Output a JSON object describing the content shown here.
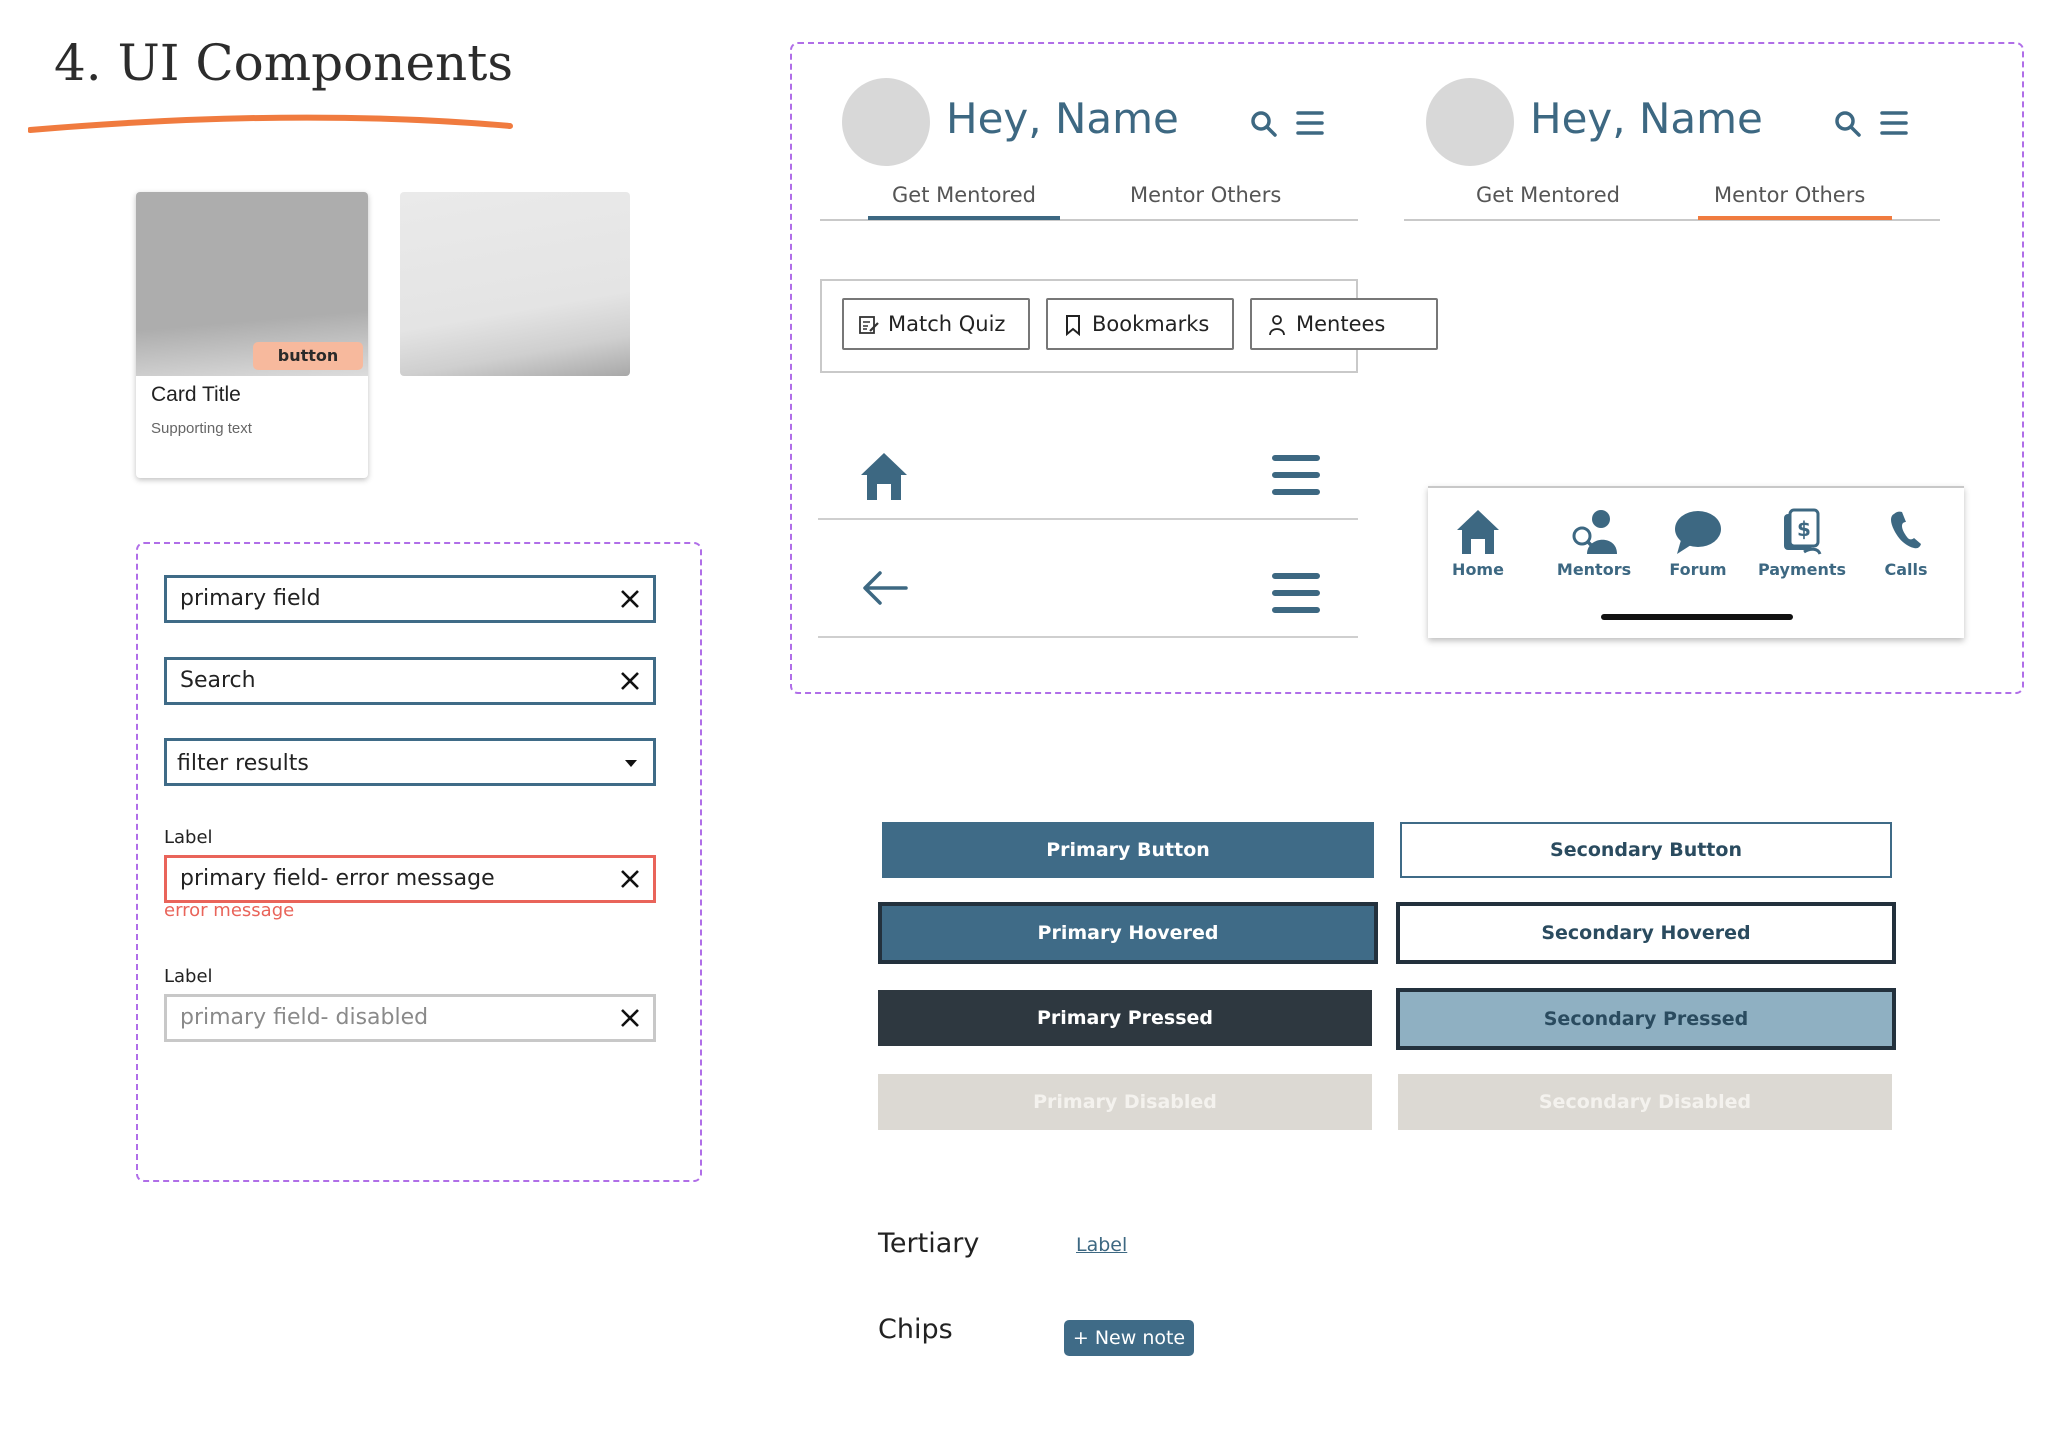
{
  "page": {
    "title": "4. UI Components"
  },
  "card": {
    "badge": "button",
    "title": "Card Title",
    "supporting": "Supporting text"
  },
  "fields": {
    "primary": "primary field",
    "search": "Search",
    "filter": "filter results",
    "error_label": "Label",
    "error_value": "primary field- error message",
    "error_message": "error message",
    "disabled_label": "Label",
    "disabled_value": "primary field- disabled"
  },
  "headers": [
    {
      "greeting": "Hey, Name",
      "tabs": [
        "Get Mentored",
        "Mentor Others"
      ],
      "active_tab": "Get Mentored",
      "indicator_color": "#3d6882"
    },
    {
      "greeting": "Hey, Name",
      "tabs": [
        "Get Mentored",
        "Mentor Others"
      ],
      "active_tab": "Mentor Others",
      "indicator_color": "#f07b3f"
    }
  ],
  "chips_row": [
    {
      "label": "Match Quiz",
      "icon": "quiz-icon"
    },
    {
      "label": "Bookmarks",
      "icon": "bookmark-icon"
    },
    {
      "label": "Mentees",
      "icon": "person-icon"
    }
  ],
  "bottom_nav": [
    {
      "label": "Home",
      "icon": "home-icon"
    },
    {
      "label": "Mentors",
      "icon": "mentor-search-icon"
    },
    {
      "label": "Forum",
      "icon": "chat-bubble-icon"
    },
    {
      "label": "Payments",
      "icon": "payments-icon"
    },
    {
      "label": "Calls",
      "icon": "phone-icon"
    }
  ],
  "buttons": {
    "primary": "Primary Button",
    "primary_hovered": "Primary Hovered",
    "primary_pressed": "Primary Pressed",
    "primary_disabled": "Primary Disabled",
    "secondary": "Secondary Button",
    "secondary_hovered": "Secondary Hovered",
    "secondary_pressed": "Secondary Pressed",
    "secondary_disabled": "Secondary Disabled"
  },
  "tertiary": {
    "section": "Tertiary",
    "link": "Label"
  },
  "chips": {
    "section": "Chips",
    "chip": "+ New note"
  },
  "colors": {
    "brand": "#3f6b87",
    "accent": "#f07b3f",
    "error": "#e9645a",
    "frame": "#b06ee8",
    "pressed_dark": "#2e3840",
    "secondary_pressed": "#8fb0c2",
    "disabled": "#dcd9d3"
  }
}
